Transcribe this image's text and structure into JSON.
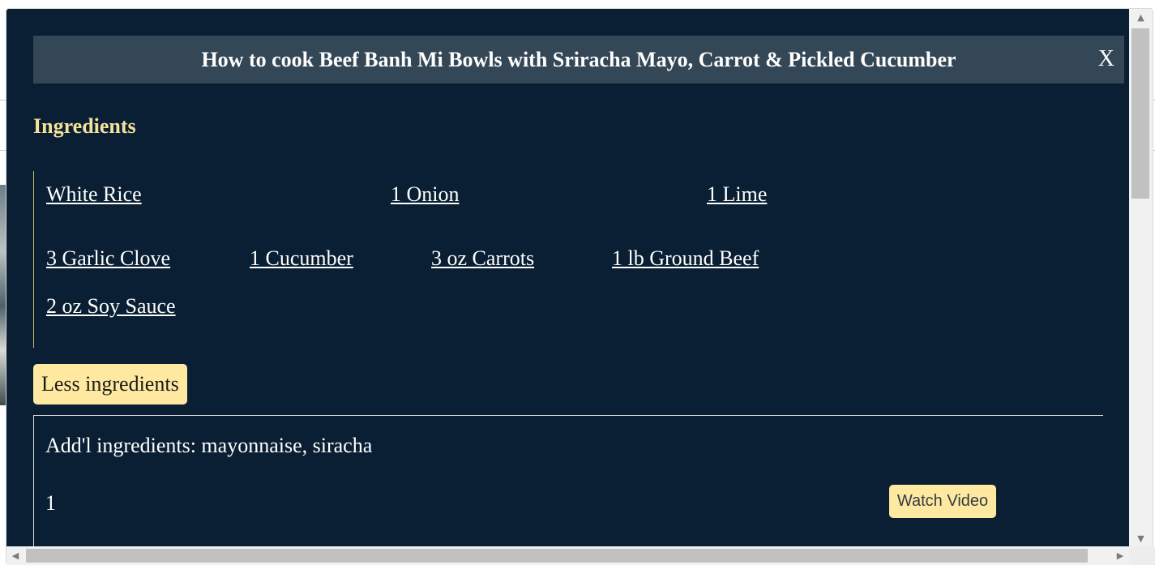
{
  "modal": {
    "title": "How to cook Beef Banh Mi Bowls with Sriracha Mayo, Carrot & Pickled Cucumber",
    "close_label": "X"
  },
  "ingredients": {
    "heading": "Ingredients",
    "items": [
      "White Rice",
      "1 Onion",
      "1 Lime",
      "3 Garlic Clove",
      "1 Cucumber",
      "3 oz Carrots",
      "1 lb Ground Beef",
      "2 oz Soy Sauce"
    ],
    "toggle_label": "Less ingredients"
  },
  "details": {
    "additional": "Add'l ingredients: mayonnaise, siracha",
    "step_number": "1",
    "watch_video_label": "Watch Video"
  },
  "scrollbars": {
    "up_arrow": "▲",
    "down_arrow": "▼",
    "left_arrow": "◀",
    "right_arrow": "▶"
  }
}
